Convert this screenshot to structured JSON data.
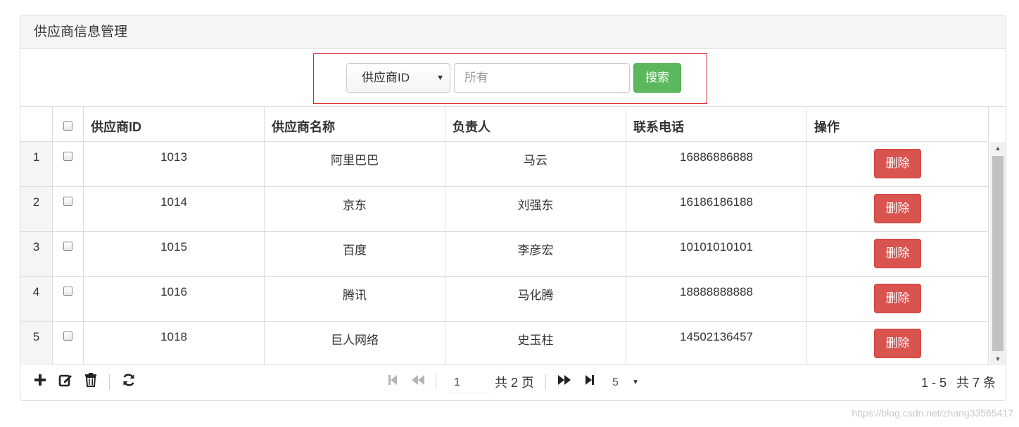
{
  "panel": {
    "title": "供应商信息管理"
  },
  "search": {
    "select_value": "供应商ID",
    "input_placeholder": "所有",
    "button_label": "搜索"
  },
  "table": {
    "headers": {
      "id": "供应商ID",
      "name": "供应商名称",
      "manager": "负责人",
      "phone": "联系电话",
      "ops": "操作"
    },
    "rows": [
      {
        "index": "1",
        "id": "1013",
        "name": "阿里巴巴",
        "manager": "马云",
        "phone": "16886886888",
        "delete_label": "删除"
      },
      {
        "index": "2",
        "id": "1014",
        "name": "京东",
        "manager": "刘强东",
        "phone": "16186186188",
        "delete_label": "删除"
      },
      {
        "index": "3",
        "id": "1015",
        "name": "百度",
        "manager": "李彦宏",
        "phone": "10101010101",
        "delete_label": "删除"
      },
      {
        "index": "4",
        "id": "1016",
        "name": "腾讯",
        "manager": "马化腾",
        "phone": "18888888888",
        "delete_label": "删除"
      },
      {
        "index": "5",
        "id": "1018",
        "name": "巨人网络",
        "manager": "史玉柱",
        "phone": "14502136457",
        "delete_label": "删除"
      }
    ]
  },
  "toolbar": {
    "icons": [
      "add-icon",
      "edit-icon",
      "delete-icon",
      "refresh-icon"
    ]
  },
  "pager": {
    "current_page": "1",
    "total_pages_text": "共 2 页",
    "page_size": "5",
    "range_text": "1 - 5",
    "total_records_text": "共 7 条"
  },
  "watermark": "https://blog.csdn.net/zhang33565417",
  "colors": {
    "success": "#5cb85c",
    "danger": "#d9534f",
    "highlight_border": "#e0262b"
  }
}
